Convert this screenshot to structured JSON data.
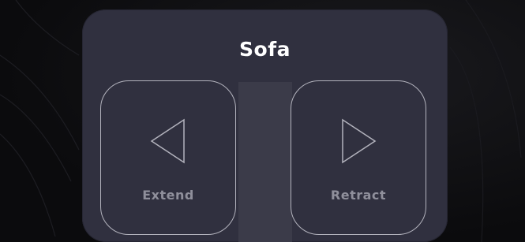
{
  "panel": {
    "title": "Sofa",
    "buttons": {
      "extend": {
        "label": "Extend",
        "icon": "triangle-left-icon"
      },
      "retract": {
        "label": "Retract",
        "icon": "triangle-right-icon"
      }
    }
  },
  "colors": {
    "panel_background": "#30303f",
    "button_border": "#b3b3bd",
    "label_text": "#8f8f9b",
    "title_text": "#ffffff"
  }
}
